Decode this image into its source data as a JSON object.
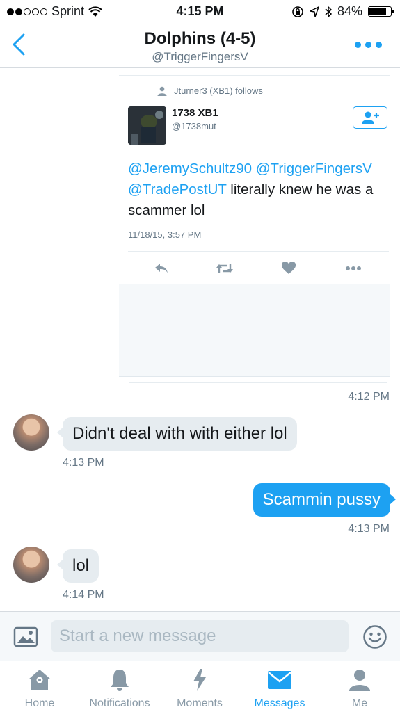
{
  "status_bar": {
    "carrier": "Sprint",
    "time": "4:15 PM",
    "battery": "84%",
    "battery_level": 0.84,
    "signal_bars": 2
  },
  "header": {
    "title": "Dolphins (4-5)",
    "subtitle": "@TriggerFingersV"
  },
  "tweet": {
    "follows_text": "Jturner3 (XB1) follows",
    "author_name": "1738 XB1",
    "author_handle": "@1738mut",
    "mention_1": "@JeremySchultz90",
    "mention_2": "@TriggerFingersV",
    "mention_3": "@TradePostUT",
    "body": " literally knew he was a scammer lol",
    "timestamp": "11/18/15, 3:57 PM",
    "shared_at": "4:12 PM"
  },
  "messages": [
    {
      "direction": "in",
      "text": "Didn't deal with with either lol",
      "time": "4:13 PM"
    },
    {
      "direction": "out",
      "text": "Scammin pussy",
      "time": "4:13 PM"
    },
    {
      "direction": "in",
      "text": "lol",
      "time": "4:14 PM"
    }
  ],
  "composer": {
    "placeholder": "Start a new message"
  },
  "tabs": [
    {
      "label": "Home",
      "icon": "home-icon"
    },
    {
      "label": "Notifications",
      "icon": "bell-icon"
    },
    {
      "label": "Moments",
      "icon": "lightning-icon"
    },
    {
      "label": "Messages",
      "icon": "envelope-icon",
      "active": true
    },
    {
      "label": "Me",
      "icon": "person-icon"
    }
  ],
  "colors": {
    "accent": "#1da1f2",
    "bubble_in": "#e6ecf0",
    "muted": "#657786"
  }
}
